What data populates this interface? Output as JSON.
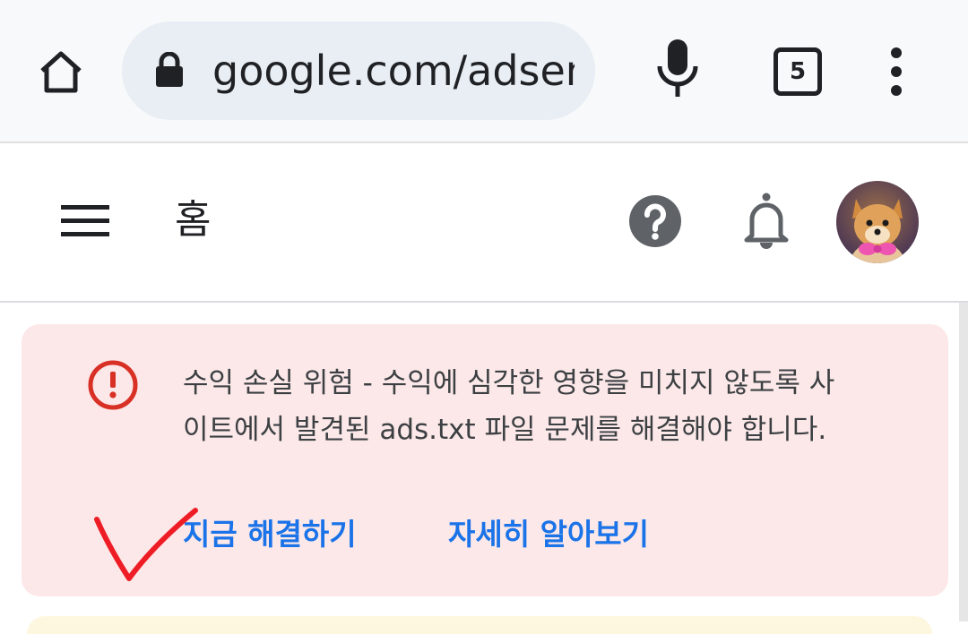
{
  "browser": {
    "url": "google.com/adsense",
    "tab_count": "5",
    "icons": {
      "home": "home-icon",
      "lock": "lock-icon",
      "mic": "mic-icon",
      "tabs": "tabs-icon",
      "menu": "more-vert-icon"
    }
  },
  "header": {
    "title": "홈",
    "icons": {
      "menu": "hamburger-menu-icon",
      "help": "help-icon",
      "notifications": "bell-icon",
      "avatar": "avatar-icon"
    }
  },
  "alert": {
    "message": "수익 손실 위험 - 수익에 심각한 영향을 미치지 않도록 사이트에서 발견된 ads.txt 파일 문제를 해결해야 합니다.",
    "fix_now_label": "지금 해결하기",
    "learn_more_label": "자세히 알아보기",
    "icon": "error-icon"
  },
  "colors": {
    "alert_bg": "#fce8e8",
    "error_red": "#d93025",
    "link_blue": "#1a73e8",
    "annotation_red": "#ee1c25"
  }
}
